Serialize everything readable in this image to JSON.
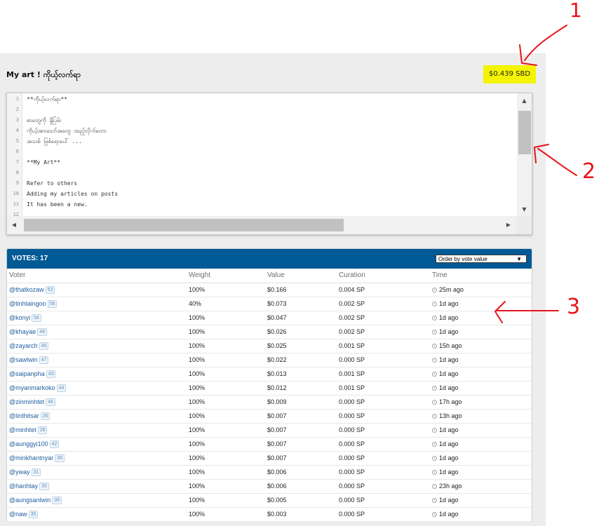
{
  "post": {
    "title": "My art ! ကိုယ့်လက်ရာ",
    "payout": "$0.439 SBD"
  },
  "editor": {
    "line_numbers": [
      "1",
      "2",
      "3",
      "4",
      "5",
      "6",
      "7",
      "8",
      "9",
      "10",
      "11",
      "12"
    ],
    "lines": [
      "**ကိုယ့်လက်ရာ**",
      "",
      "စာတွေကို နှိုပြမ်း",
      "ကိုယ့်အားသော်အတွေ ထည့်လိုက်တော",
      "အသစ် ဖြစ်ရောပေါ် ...",
      "",
      "**My Art**",
      "",
      "Refer to others",
      "Adding my articles on posts",
      "It has been a new.",
      ""
    ]
  },
  "votes": {
    "title": "VOTES: 17",
    "order_select": "Order by vote value",
    "columns": [
      "Voter",
      "Weight",
      "Value",
      "Curation",
      "Time"
    ],
    "rows": [
      {
        "voter": "@thatkozaw",
        "rep": "52",
        "weight": "100%",
        "value": "$0.166",
        "curation": "0.004 SP",
        "time": "25m ago"
      },
      {
        "voter": "@tinhlaingoo",
        "rep": "56",
        "weight": "40%",
        "value": "$0.073",
        "curation": "0.002 SP",
        "time": "1d ago"
      },
      {
        "voter": "@konyi",
        "rep": "54",
        "weight": "100%",
        "value": "$0.047",
        "curation": "0.002 SP",
        "time": "1d ago"
      },
      {
        "voter": "@khayae",
        "rep": "48",
        "weight": "100%",
        "value": "$0.026",
        "curation": "0.002 SP",
        "time": "1d ago"
      },
      {
        "voter": "@zayarch",
        "rep": "45",
        "weight": "100%",
        "value": "$0.025",
        "curation": "0.001 SP",
        "time": "15h ago"
      },
      {
        "voter": "@sawlwin",
        "rep": "47",
        "weight": "100%",
        "value": "$0.022",
        "curation": "0.000 SP",
        "time": "1d ago"
      },
      {
        "voter": "@saipanpha",
        "rep": "43",
        "weight": "100%",
        "value": "$0.013",
        "curation": "0.001 SP",
        "time": "1d ago"
      },
      {
        "voter": "@myanmarkoko",
        "rep": "44",
        "weight": "100%",
        "value": "$0.012",
        "curation": "0.001 SP",
        "time": "1d ago"
      },
      {
        "voter": "@zinminhtet",
        "rep": "46",
        "weight": "100%",
        "value": "$0.009",
        "curation": "0.000 SP",
        "time": "17h ago"
      },
      {
        "voter": "@linthitsar",
        "rep": "26",
        "weight": "100%",
        "value": "$0.007",
        "curation": "0.000 SP",
        "time": "13h ago"
      },
      {
        "voter": "@minhtet",
        "rep": "28",
        "weight": "100%",
        "value": "$0.007",
        "curation": "0.000 SP",
        "time": "1d ago"
      },
      {
        "voter": "@aunggyi100",
        "rep": "42",
        "weight": "100%",
        "value": "$0.007",
        "curation": "0.000 SP",
        "time": "1d ago"
      },
      {
        "voter": "@minkhantnyar",
        "rep": "36",
        "weight": "100%",
        "value": "$0.007",
        "curation": "0.000 SP",
        "time": "1d ago"
      },
      {
        "voter": "@yway",
        "rep": "31",
        "weight": "100%",
        "value": "$0.006",
        "curation": "0.000 SP",
        "time": "1d ago"
      },
      {
        "voter": "@hanhtay",
        "rep": "35",
        "weight": "100%",
        "value": "$0.006",
        "curation": "0.000 SP",
        "time": "23h ago"
      },
      {
        "voter": "@aungsanlwin",
        "rep": "36",
        "weight": "100%",
        "value": "$0.005",
        "curation": "0.000 SP",
        "time": "1d ago"
      },
      {
        "voter": "@naw",
        "rep": "35",
        "weight": "100%",
        "value": "$0.003",
        "curation": "0.000 SP",
        "time": "1d ago"
      }
    ]
  },
  "annotations": {
    "color": "#e8141b",
    "labels": [
      "1",
      "2",
      "3"
    ]
  },
  "colors": {
    "header_blue": "#005a96",
    "payout_yellow": "#f4f400",
    "panel_gray": "#ededed"
  }
}
